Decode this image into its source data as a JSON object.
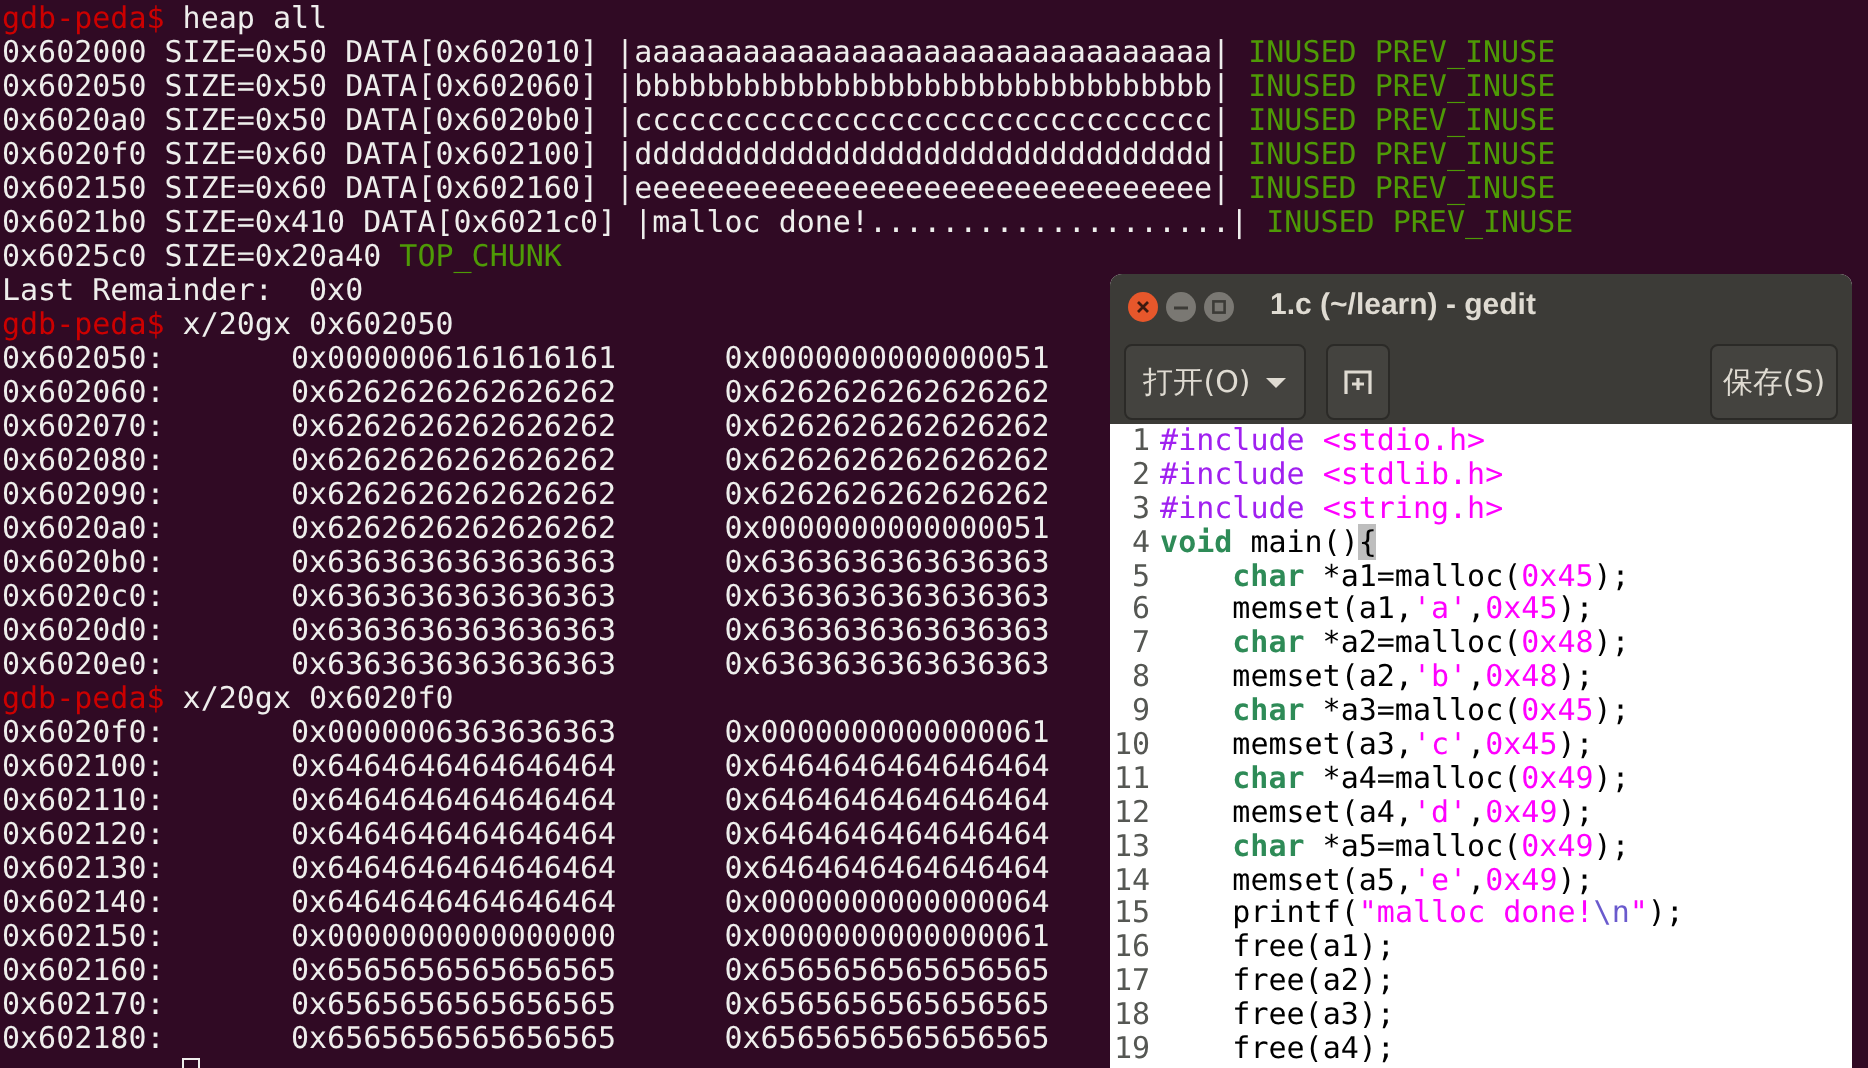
{
  "terminal": {
    "lines": [
      {
        "kind": "prompt",
        "prompt": "gdb-peda$",
        "command": "heap all"
      },
      {
        "kind": "chunk",
        "text": "0x602000 SIZE=0x50 DATA[0x602010] |aaaaaaaaaaaaaaaaaaaaaaaaaaaaaaaa|",
        "flags": "INUSED PREV_INUSE"
      },
      {
        "kind": "chunk",
        "text": "0x602050 SIZE=0x50 DATA[0x602060] |bbbbbbbbbbbbbbbbbbbbbbbbbbbbbbbb|",
        "flags": "INUSED PREV_INUSE"
      },
      {
        "kind": "chunk",
        "text": "0x6020a0 SIZE=0x50 DATA[0x6020b0] |cccccccccccccccccccccccccccccccc|",
        "flags": "INUSED PREV_INUSE"
      },
      {
        "kind": "chunk",
        "text": "0x6020f0 SIZE=0x60 DATA[0x602100] |dddddddddddddddddddddddddddddddd|",
        "flags": "INUSED PREV_INUSE"
      },
      {
        "kind": "chunk",
        "text": "0x602150 SIZE=0x60 DATA[0x602160] |eeeeeeeeeeeeeeeeeeeeeeeeeeeeeeee|",
        "flags": "INUSED PREV_INUSE"
      },
      {
        "kind": "chunk",
        "text": "0x6021b0 SIZE=0x410 DATA[0x6021c0] |malloc done!....................|",
        "flags": "INUSED PREV_INUSE"
      },
      {
        "kind": "chunk",
        "text": "0x6025c0 SIZE=0x20a40",
        "flags": "TOP_CHUNK"
      },
      {
        "kind": "text",
        "text": "Last Remainder:  0x0"
      },
      {
        "kind": "prompt",
        "prompt": "gdb-peda$",
        "command": "x/20gx 0x602050"
      },
      {
        "kind": "words",
        "address": "0x602050:",
        "values": [
          "0x0000006161616161",
          "0x0000000000000051"
        ]
      },
      {
        "kind": "words",
        "address": "0x602060:",
        "values": [
          "0x6262626262626262",
          "0x6262626262626262"
        ]
      },
      {
        "kind": "words",
        "address": "0x602070:",
        "values": [
          "0x6262626262626262",
          "0x6262626262626262"
        ]
      },
      {
        "kind": "words",
        "address": "0x602080:",
        "values": [
          "0x6262626262626262",
          "0x6262626262626262"
        ]
      },
      {
        "kind": "words",
        "address": "0x602090:",
        "values": [
          "0x6262626262626262",
          "0x6262626262626262"
        ]
      },
      {
        "kind": "words",
        "address": "0x6020a0:",
        "values": [
          "0x6262626262626262",
          "0x0000000000000051"
        ]
      },
      {
        "kind": "words",
        "address": "0x6020b0:",
        "values": [
          "0x6363636363636363",
          "0x6363636363636363"
        ]
      },
      {
        "kind": "words",
        "address": "0x6020c0:",
        "values": [
          "0x6363636363636363",
          "0x6363636363636363"
        ]
      },
      {
        "kind": "words",
        "address": "0x6020d0:",
        "values": [
          "0x6363636363636363",
          "0x6363636363636363"
        ]
      },
      {
        "kind": "words",
        "address": "0x6020e0:",
        "values": [
          "0x6363636363636363",
          "0x6363636363636363"
        ]
      },
      {
        "kind": "prompt",
        "prompt": "gdb-peda$",
        "command": "x/20gx 0x6020f0"
      },
      {
        "kind": "words",
        "address": "0x6020f0:",
        "values": [
          "0x0000006363636363",
          "0x0000000000000061"
        ]
      },
      {
        "kind": "words",
        "address": "0x602100:",
        "values": [
          "0x6464646464646464",
          "0x6464646464646464"
        ]
      },
      {
        "kind": "words",
        "address": "0x602110:",
        "values": [
          "0x6464646464646464",
          "0x6464646464646464"
        ]
      },
      {
        "kind": "words",
        "address": "0x602120:",
        "values": [
          "0x6464646464646464",
          "0x6464646464646464"
        ]
      },
      {
        "kind": "words",
        "address": "0x602130:",
        "values": [
          "0x6464646464646464",
          "0x6464646464646464"
        ]
      },
      {
        "kind": "words",
        "address": "0x602140:",
        "values": [
          "0x6464646464646464",
          "0x0000000000000064"
        ]
      },
      {
        "kind": "words",
        "address": "0x602150:",
        "values": [
          "0x0000000000000000",
          "0x0000000000000061"
        ]
      },
      {
        "kind": "words",
        "address": "0x602160:",
        "values": [
          "0x6565656565656565",
          "0x6565656565656565"
        ]
      },
      {
        "kind": "words",
        "address": "0x602170:",
        "values": [
          "0x6565656565656565",
          "0x6565656565656565"
        ]
      },
      {
        "kind": "words",
        "address": "0x602180:",
        "values": [
          "0x6565656565656565",
          "0x6565656565656565"
        ]
      },
      {
        "kind": "cursor"
      }
    ]
  },
  "editor": {
    "title": "1.c (~/learn) - gedit",
    "open_button": "打开(O)",
    "save_button": "保存(S)",
    "lines": [
      {
        "number": "1",
        "tokens": [
          {
            "kind": "preproc",
            "text": "#include"
          },
          {
            "kind": "include",
            "text": "<stdio.h>"
          }
        ]
      },
      {
        "number": "2",
        "tokens": [
          {
            "kind": "preproc",
            "text": "#include"
          },
          {
            "kind": "include",
            "text": "<stdlib.h>"
          }
        ]
      },
      {
        "number": "3",
        "tokens": [
          {
            "kind": "preproc",
            "text": "#include"
          },
          {
            "kind": "include",
            "text": "<string.h>"
          }
        ]
      },
      {
        "number": "4",
        "tokens": [
          {
            "kind": "keyword",
            "text": "void"
          },
          {
            "kind": "plain",
            "text": " main()"
          },
          {
            "kind": "bracket_match",
            "text": "{"
          }
        ]
      },
      {
        "number": "5",
        "tokens": [
          {
            "kind": "keyword",
            "text": "char"
          },
          {
            "kind": "plain",
            "text": " *a1=malloc("
          },
          {
            "kind": "number",
            "text": "0x45"
          },
          {
            "kind": "plain",
            "text": ");"
          }
        ]
      },
      {
        "number": "6",
        "tokens": [
          {
            "kind": "plain",
            "text": "    memset(a1,"
          },
          {
            "kind": "string",
            "text": "'a'"
          },
          {
            "kind": "plain",
            "text": ","
          },
          {
            "kind": "number",
            "text": "0x45"
          },
          {
            "kind": "plain",
            "text": ");"
          }
        ]
      },
      {
        "number": "7",
        "tokens": [
          {
            "kind": "keyword",
            "text": "char"
          },
          {
            "kind": "plain",
            "text": " *a2=malloc("
          },
          {
            "kind": "number",
            "text": "0x48"
          },
          {
            "kind": "plain",
            "text": ");"
          }
        ]
      },
      {
        "number": "8",
        "tokens": [
          {
            "kind": "plain",
            "text": "    memset(a2,"
          },
          {
            "kind": "string",
            "text": "'b'"
          },
          {
            "kind": "plain",
            "text": ","
          },
          {
            "kind": "number",
            "text": "0x48"
          },
          {
            "kind": "plain",
            "text": ");"
          }
        ]
      },
      {
        "number": "9",
        "tokens": [
          {
            "kind": "keyword",
            "text": "char"
          },
          {
            "kind": "plain",
            "text": " *a3=malloc("
          },
          {
            "kind": "number",
            "text": "0x45"
          },
          {
            "kind": "plain",
            "text": ");"
          }
        ]
      },
      {
        "number": "10",
        "tokens": [
          {
            "kind": "plain",
            "text": "    memset(a3,"
          },
          {
            "kind": "string",
            "text": "'c'"
          },
          {
            "kind": "plain",
            "text": ","
          },
          {
            "kind": "number",
            "text": "0x45"
          },
          {
            "kind": "plain",
            "text": ");"
          }
        ]
      },
      {
        "number": "11",
        "tokens": [
          {
            "kind": "keyword",
            "text": "char"
          },
          {
            "kind": "plain",
            "text": " *a4=malloc("
          },
          {
            "kind": "number",
            "text": "0x49"
          },
          {
            "kind": "plain",
            "text": ");"
          }
        ]
      },
      {
        "number": "12",
        "tokens": [
          {
            "kind": "plain",
            "text": "    memset(a4,"
          },
          {
            "kind": "string",
            "text": "'d'"
          },
          {
            "kind": "plain",
            "text": ","
          },
          {
            "kind": "number",
            "text": "0x49"
          },
          {
            "kind": "plain",
            "text": ");"
          }
        ]
      },
      {
        "number": "13",
        "tokens": [
          {
            "kind": "keyword",
            "text": "char"
          },
          {
            "kind": "plain",
            "text": " *a5=malloc("
          },
          {
            "kind": "number",
            "text": "0x49"
          },
          {
            "kind": "plain",
            "text": ");"
          }
        ]
      },
      {
        "number": "14",
        "tokens": [
          {
            "kind": "plain",
            "text": "    memset(a5,"
          },
          {
            "kind": "string",
            "text": "'e'"
          },
          {
            "kind": "plain",
            "text": ","
          },
          {
            "kind": "number",
            "text": "0x49"
          },
          {
            "kind": "plain",
            "text": ");"
          }
        ]
      },
      {
        "number": "15",
        "tokens": [
          {
            "kind": "plain",
            "text": "    printf("
          },
          {
            "kind": "string",
            "text": "\"malloc done!"
          },
          {
            "kind": "escape",
            "text": "\\n"
          },
          {
            "kind": "string",
            "text": "\""
          },
          {
            "kind": "plain",
            "text": ");"
          }
        ]
      },
      {
        "number": "16",
        "tokens": [
          {
            "kind": "plain",
            "text": "    free(a1);"
          }
        ]
      },
      {
        "number": "17",
        "tokens": [
          {
            "kind": "plain",
            "text": "    free(a2);"
          }
        ]
      },
      {
        "number": "18",
        "tokens": [
          {
            "kind": "plain",
            "text": "    free(a3);"
          }
        ]
      },
      {
        "number": "19",
        "tokens": [
          {
            "kind": "plain",
            "text": "    free(a4);"
          }
        ]
      }
    ]
  }
}
